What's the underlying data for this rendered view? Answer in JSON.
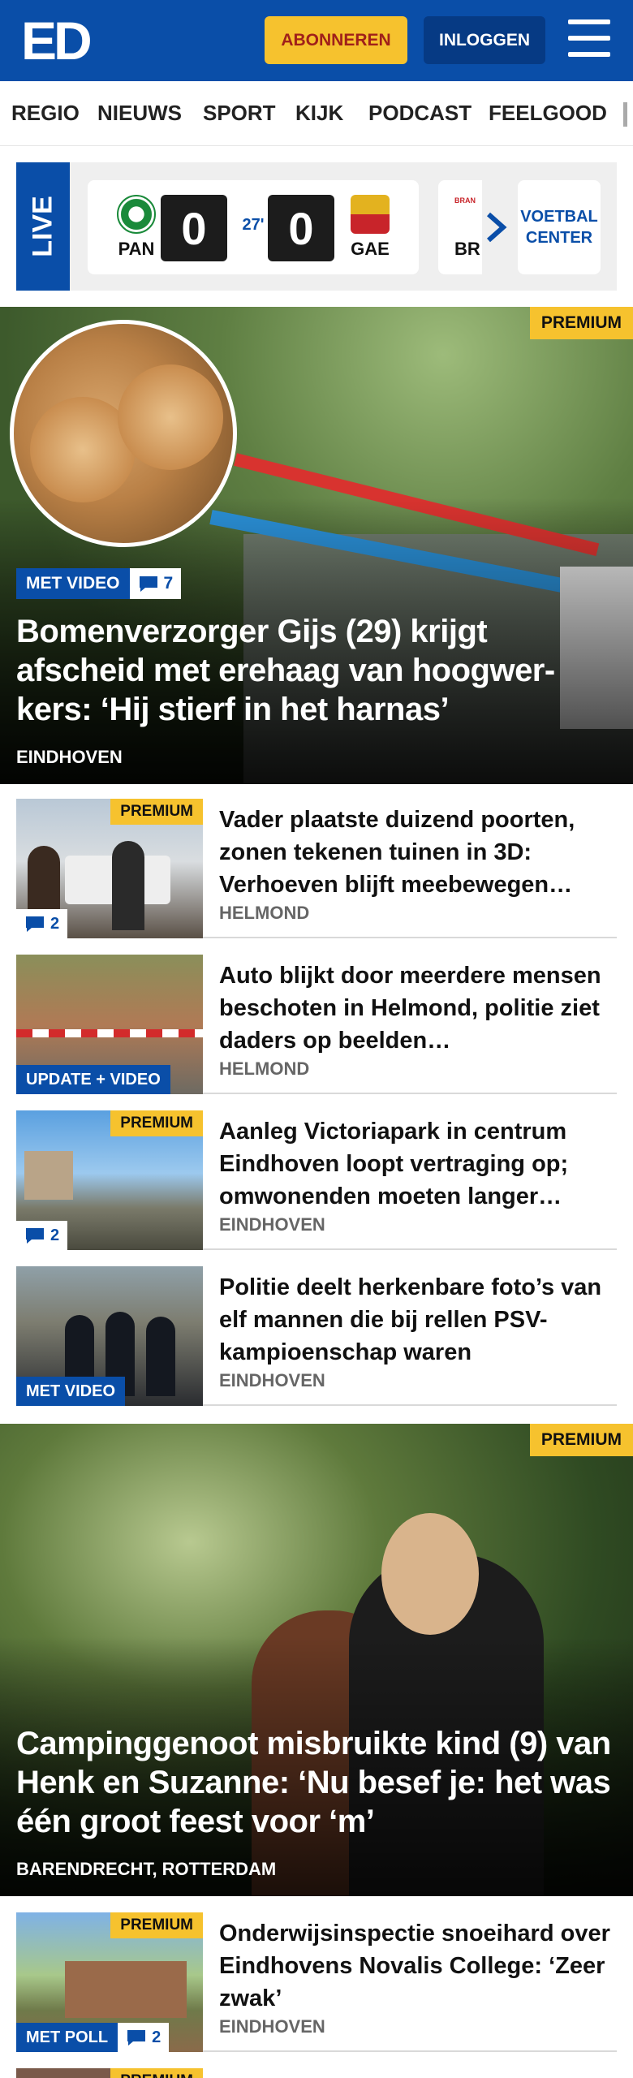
{
  "header": {
    "logo": "ED",
    "subscribe_label": "ABONNEREN",
    "login_label": "INLOGGEN",
    "menu_icon": "hamburger-menu-icon",
    "brand_color": "#0a4ea8",
    "accent_color": "#f6c22e"
  },
  "nav": {
    "items": [
      "REGIO",
      "NIEUWS",
      "SPORT",
      "KIJK",
      "PODCAST",
      "FEELGOOD"
    ]
  },
  "live": {
    "label": "LIVE",
    "match": {
      "home_code": "PAN",
      "away_code": "GAE",
      "home_score": "0",
      "away_score": "0",
      "minute": "27'"
    },
    "next_match_code": "BR",
    "next_match_crest_text": "BRAN",
    "voetbalcenter_line1": "VOETBAL",
    "voetbalcenter_line2": "CENTER"
  },
  "hero": {
    "premium": "PREMIUM",
    "badge": "MET VIDEO",
    "comments": "7",
    "title": "Bomenverzorger Gijs (29) krijgt afscheid met erehaag van hoogwer­kers: ‘Hij stierf in het harnas’",
    "location": "EINDHOVEN"
  },
  "articles": [
    {
      "premium": "PREMIUM",
      "badge": "",
      "comments": "2",
      "title": "Vader plaatste duizend poorten, zonen tekenen tuinen in 3D: Verhoeven blijft meebewegen…",
      "location": "HELMOND"
    },
    {
      "premium": "",
      "badge": "UPDATE + VIDEO",
      "comments": "",
      "title": "Auto blijkt door meerdere mensen beschoten in Helmond, politie ziet daders op beelden…",
      "location": "HELMOND"
    },
    {
      "premium": "PREMIUM",
      "badge": "",
      "comments": "2",
      "title": "Aanleg Victoriapark in centrum Eindhoven loopt vertraging op; omwonenden moeten langer…",
      "location": "EINDHOVEN"
    },
    {
      "premium": "",
      "badge": "MET VIDEO",
      "comments": "",
      "title": "Politie deelt herkenbare foto’s van elf mannen die bij rellen PSV-kampioenschap waren",
      "location": "EINDHOVEN"
    }
  ],
  "hero2": {
    "premium": "PREMIUM",
    "title": "Campinggenoot misbruikte kind (9) van Henk en Suzanne: ‘Nu besef je: het was één groot feest voor ‘m’",
    "location": "BARENDRECHT, ROTTERDAM"
  },
  "article_last": {
    "premium": "PREMIUM",
    "badge": "MET POLL",
    "comments": "2",
    "title": "Onderwijsinspectie snoeihard over Eindhovens Novalis College: ‘Zeer zwak’",
    "location": "EINDHOVEN"
  },
  "article_cut": {
    "premium": "PREMIUM"
  }
}
